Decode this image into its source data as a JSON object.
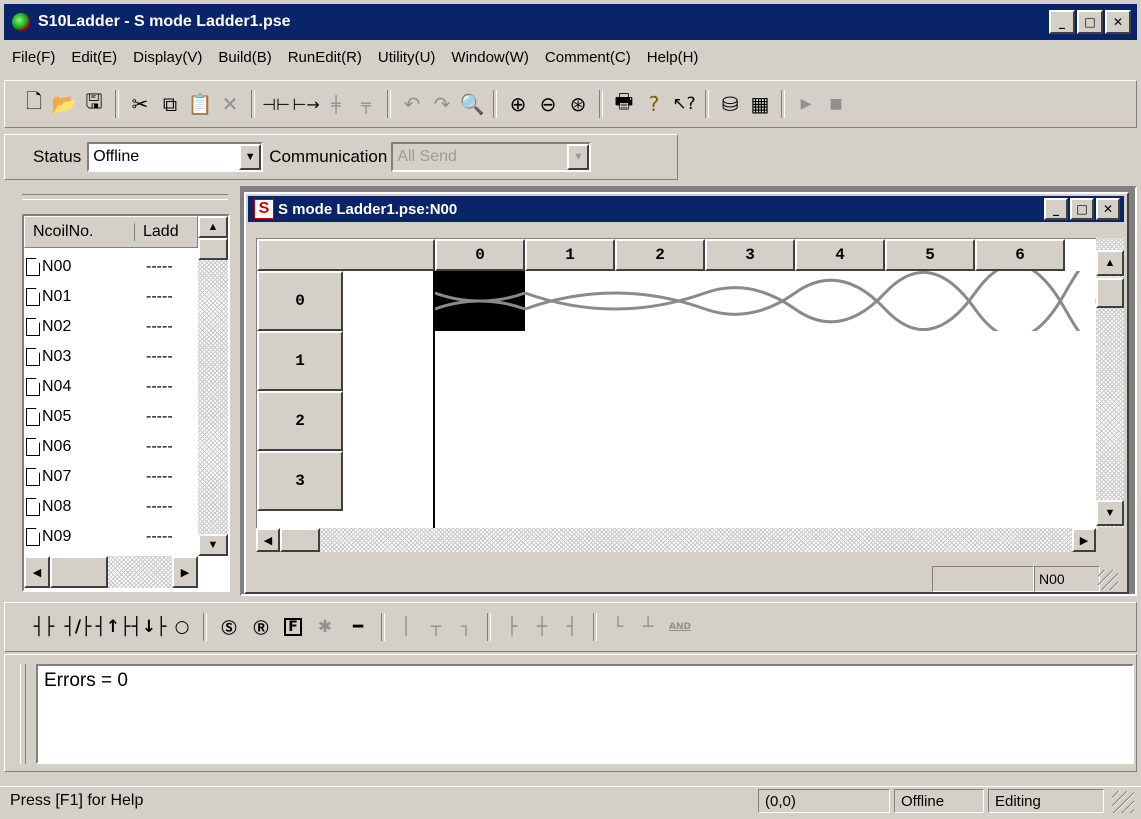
{
  "app": {
    "title": "S10Ladder - S mode Ladder1.pse",
    "menu": [
      "File(F)",
      "Edit(E)",
      "Display(V)",
      "Build(B)",
      "RunEdit(R)",
      "Utility(U)",
      "Window(W)",
      "Comment(C)",
      "Help(H)"
    ]
  },
  "status_bar_top": {
    "status_label": "Status",
    "status_value": "Offline",
    "comm_label": "Communication",
    "comm_value": "All Send"
  },
  "coil_list": {
    "headers": [
      "NcoilNo.",
      "Ladd"
    ],
    "rows": [
      {
        "no": "N00",
        "val": "-----"
      },
      {
        "no": "N01",
        "val": "-----"
      },
      {
        "no": "N02",
        "val": "-----"
      },
      {
        "no": "N03",
        "val": "-----"
      },
      {
        "no": "N04",
        "val": "-----"
      },
      {
        "no": "N05",
        "val": "-----"
      },
      {
        "no": "N06",
        "val": "-----"
      },
      {
        "no": "N07",
        "val": "-----"
      },
      {
        "no": "N08",
        "val": "-----"
      },
      {
        "no": "N09",
        "val": "-----"
      }
    ]
  },
  "child_window": {
    "title": "S mode Ladder1.pse:N00",
    "columns": [
      "0",
      "1",
      "2",
      "3",
      "4",
      "5",
      "6"
    ],
    "rows": [
      "0",
      "1",
      "2",
      "3"
    ],
    "status_cell": "N00"
  },
  "output": {
    "text": "Errors = 0"
  },
  "statusbar": {
    "help": "Press [F1] for Help",
    "coord": "(0,0)",
    "mode": "Offline",
    "state": "Editing"
  },
  "colors": {
    "titlebar": "#0a246a",
    "face": "#d4d0c8",
    "cell_selected": "#000000"
  }
}
